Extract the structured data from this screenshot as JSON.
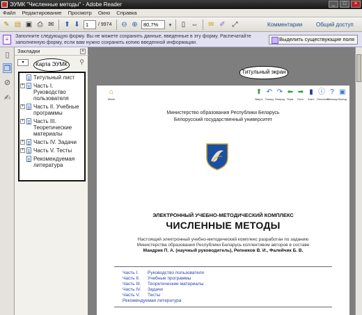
{
  "window": {
    "title": "ЭУМК \"Численные методы\" - Adobe Reader",
    "controls": [
      "_",
      "□",
      "×"
    ]
  },
  "menu": [
    "Файл",
    "Редактирование",
    "Просмотр",
    "Окно",
    "Справка"
  ],
  "toolbar": {
    "page_current": "1",
    "page_total": "/ 9974",
    "zoom": "80,7%",
    "comments_label": "Комментарии",
    "share_label": "Общий доступ"
  },
  "infobar": {
    "message": "Заполните следующую форму. Вы не можете сохранить данные, введенные в эту форму. Распечатайте заполненную форму, если вам нужно сохранить копию введенной информации.",
    "highlight_button": "Выделить существующие поля"
  },
  "bookmarks_panel": {
    "header": "Закладки",
    "items": [
      {
        "label": "Титульный лист",
        "expandable": false
      },
      {
        "label": "Часть I. Руководство пользователя",
        "expandable": true
      },
      {
        "label": "Часть II. Учебные программы",
        "expandable": true
      },
      {
        "label": "Часть III. Теоретические материалы",
        "expandable": true
      },
      {
        "label": "Часть IV. Задачи",
        "expandable": true
      },
      {
        "label": "Часть V. Тесты",
        "expandable": true
      },
      {
        "label": "Рекомендуемая литература",
        "expandable": false
      }
    ]
  },
  "callouts": {
    "map": "Карта ЭУМК",
    "title_screen": "Титульный экран"
  },
  "document": {
    "nav": {
      "home": "Меню",
      "items": [
        "Вверх",
        "Назад",
        "Вперед",
        "Перв.",
        "Посл.",
        "Закл.",
        "Описание",
        "Помощь",
        "Выход"
      ]
    },
    "ministry": "Министерство образования Республики Беларусь",
    "university": "Белорусский государственный университет",
    "complex": "ЭЛЕКТРОННЫЙ УЧЕБНО-МЕТОДИЧЕСКИЙ КОМПЛЕКС",
    "title": "ЧИСЛЕННЫЕ МЕТОДЫ",
    "description_1": "Настоящий электронный учебно-методический комплекс разработан по заданию",
    "description_2": "Министерства образования Республики Беларусь коллективом авторов в составе",
    "authors": "Мандрик П. А. (научный руководитель), Репников В. И., Фалейчик Б. В.",
    "toc": [
      {
        "part": "Часть I.",
        "title": "Руководство пользователя"
      },
      {
        "part": "Часть II.",
        "title": "Учебные программы"
      },
      {
        "part": "Часть III.",
        "title": "Теоретические материалы"
      },
      {
        "part": "Часть IV.",
        "title": "Задачи"
      },
      {
        "part": "Часть V.",
        "title": "Тесты"
      },
      {
        "part": "",
        "title": "Рекомендуемая литература"
      }
    ]
  }
}
